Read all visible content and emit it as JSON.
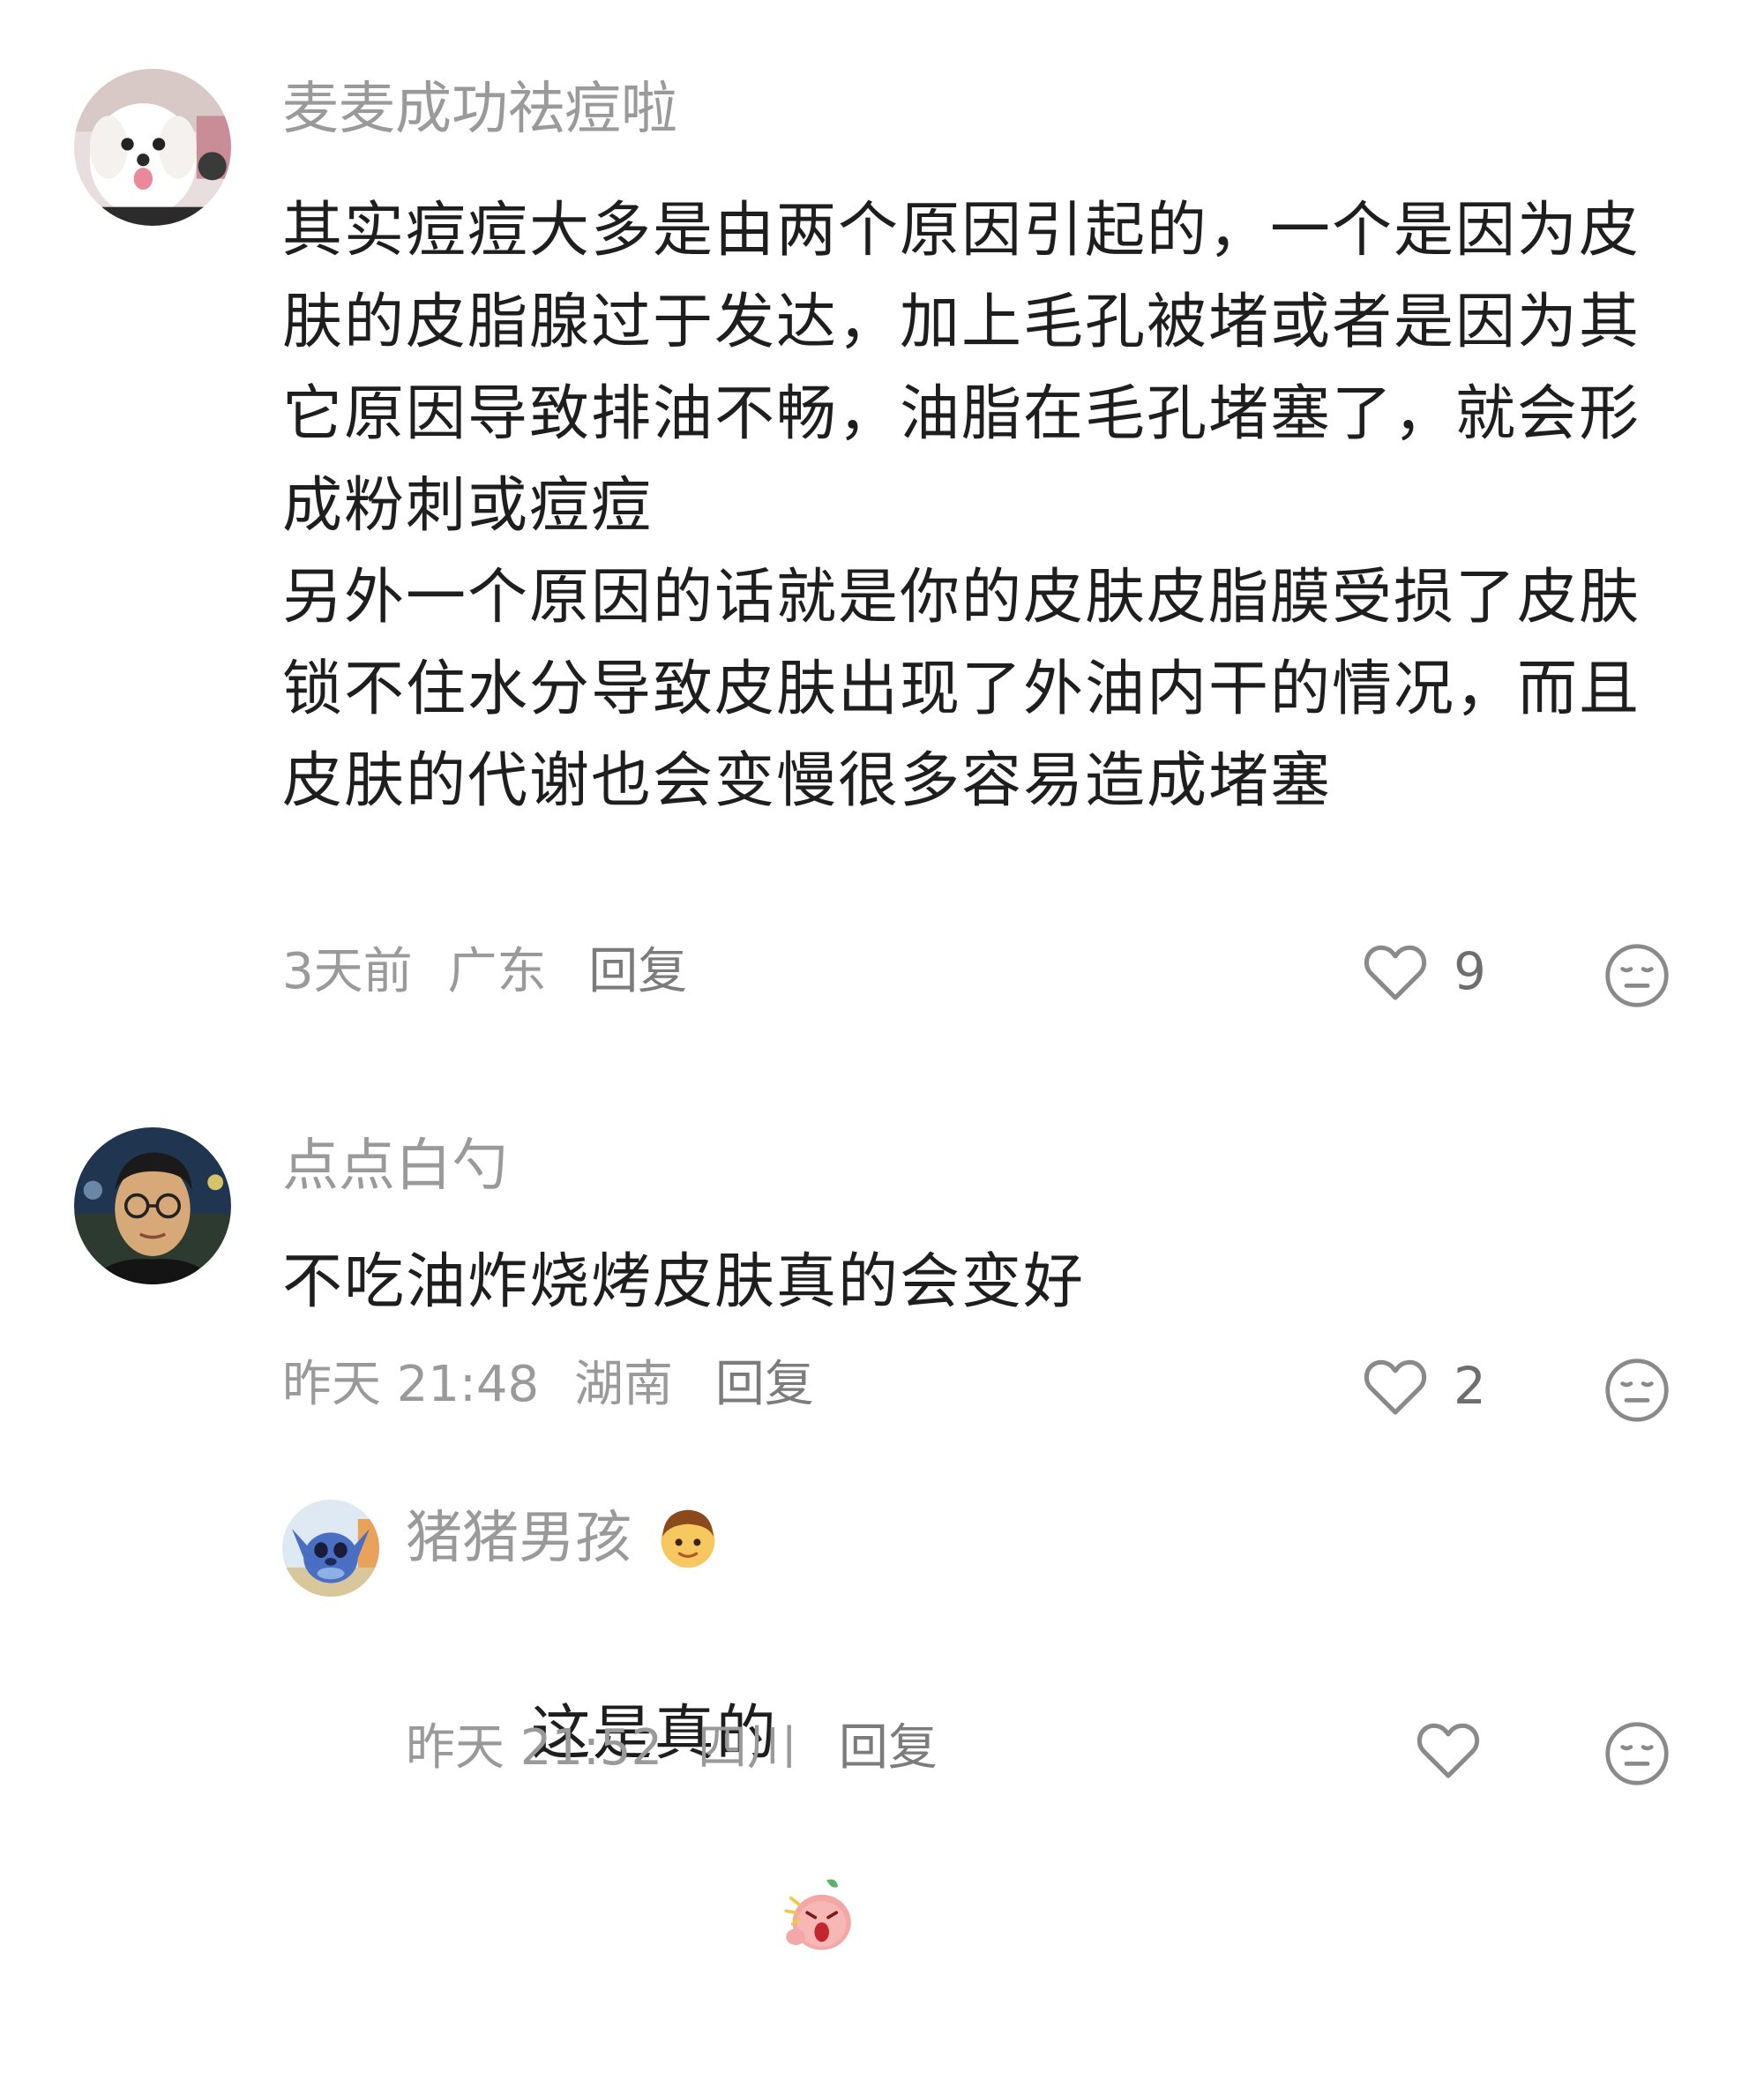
{
  "comments": [
    {
      "username": "麦麦成功祛痘啦",
      "avatar": "white-dog-avatar",
      "content": "其实痘痘大多是由两个原因引起的，一个是因为皮肤的皮脂腺过于发达，加上毛孔被堵或者是因为其它原因导致排油不畅，油脂在毛孔堵塞了，就会形成粉刺或痘痘\n另外一个原因的话就是你的皮肤皮脂膜受损了皮肤锁不住水分导致皮肤出现了外油内干的情况，而且皮肤的代谢也会变慢很多容易造成堵塞",
      "time": "3天前",
      "location": "广东",
      "reply_label": "回复",
      "like_count": "9"
    },
    {
      "username": "点点白勺",
      "avatar": "young-man-glasses-avatar",
      "content": "不吃油炸烧烤皮肤真的会变好",
      "time": "昨天 21:48",
      "location": "湖南",
      "reply_label": "回复",
      "like_count": "2",
      "replies": [
        {
          "username": "猪猪男孩",
          "username_emoji": "boy-emoji",
          "avatar": "blue-cartoon-avatar",
          "content": "这是真的",
          "content_emoji": "shocked-peach-sticker",
          "time": "昨天 21:52",
          "location": "四川",
          "reply_label": "回复",
          "like_count": ""
        }
      ]
    }
  ],
  "colors": {
    "username": "#9a9a9a",
    "content": "#1e1e1e",
    "meta": "#9a9a9a",
    "icon": "#8a8a8a"
  }
}
